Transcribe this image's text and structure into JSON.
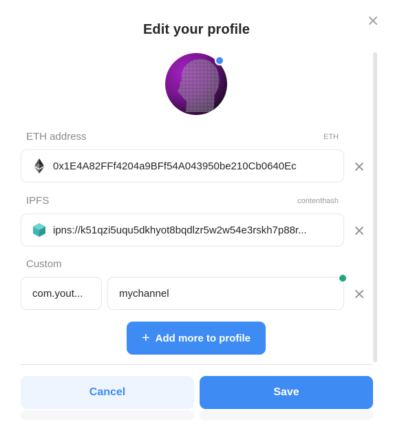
{
  "dialog": {
    "title": "Edit your profile",
    "close_icon": "close-icon"
  },
  "avatar": {
    "status_color": "#3e8bf4"
  },
  "records": {
    "eth": {
      "label": "ETH address",
      "hint": "ETH",
      "value": "0x1E4A82FFf4204a9BFf54A043950be210Cb0640Ec",
      "icon": "ethereum-icon"
    },
    "ipfs": {
      "label": "IPFS",
      "hint": "contenthash",
      "value": "ipns://k51qzi5uqu5dkhyot8bqdlzr5w2w54e3rskh7p88r...",
      "icon": "ipfs-cube-icon"
    },
    "custom": {
      "label": "Custom",
      "key": "com.yout...",
      "value": "mychannel",
      "status_color": "#22a77a"
    }
  },
  "actions": {
    "add_more": "Add more to profile",
    "cancel": "Cancel",
    "save": "Save"
  },
  "colors": {
    "accent": "#3e8bf4",
    "accent_soft": "#eef5ff"
  }
}
